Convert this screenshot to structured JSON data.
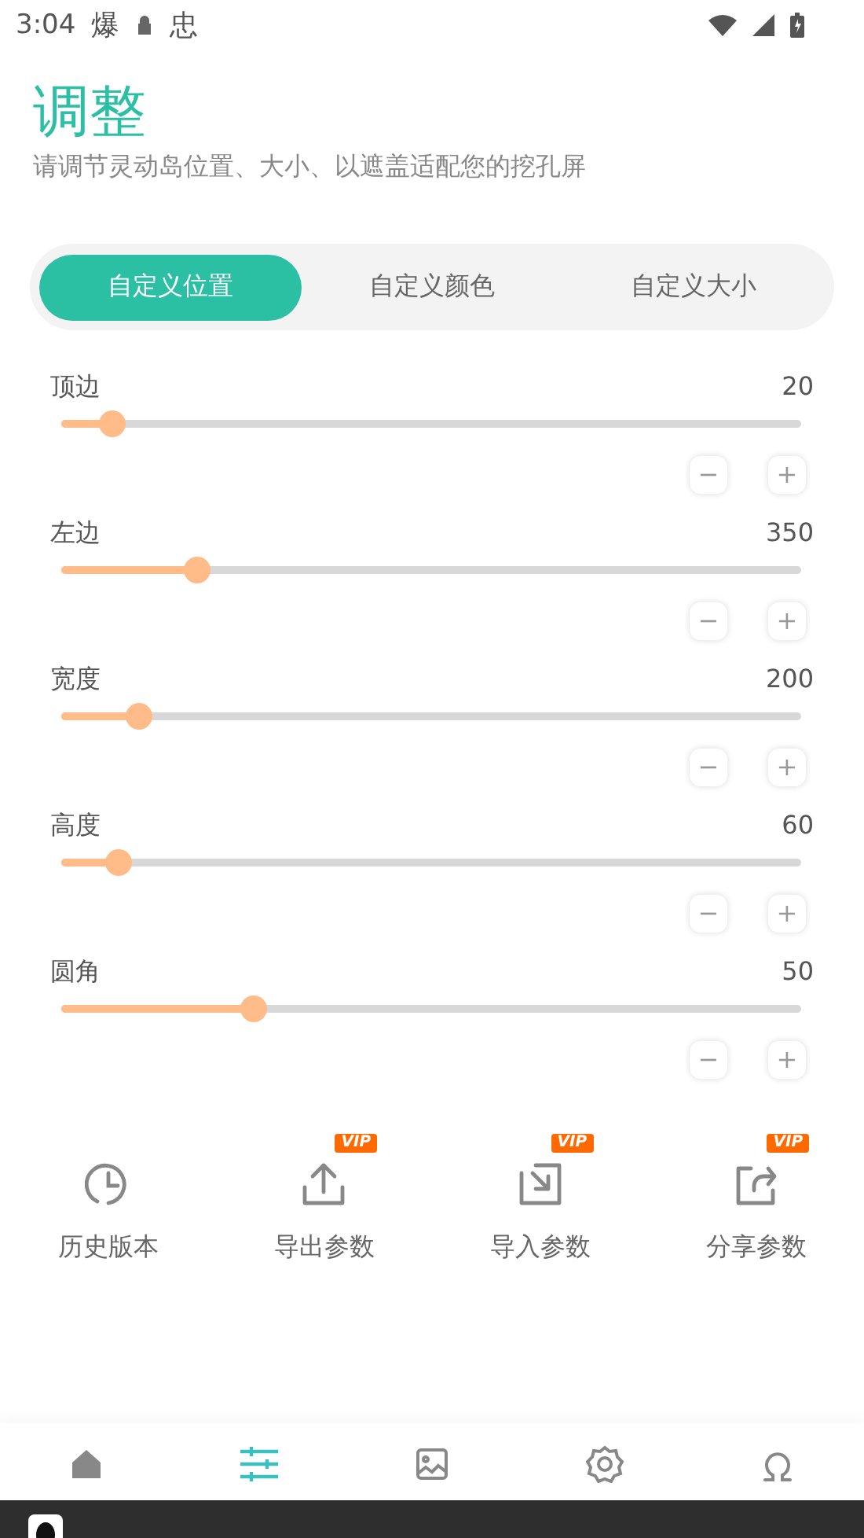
{
  "status_bar": {
    "time": "3:04",
    "notice_glyphs": [
      "爆",
      "忠"
    ]
  },
  "header": {
    "title": "调整",
    "subtitle": "请调节灵动岛位置、大小、以遮盖适配您的挖孔屏"
  },
  "tabs": [
    {
      "label": "自定义位置",
      "selected": true
    },
    {
      "label": "自定义颜色",
      "selected": false
    },
    {
      "label": "自定义大小",
      "selected": false
    }
  ],
  "sliders": [
    {
      "label": "顶边",
      "value": "20",
      "level": 0.066,
      "minus": "−",
      "plus": "+"
    },
    {
      "label": "左边",
      "value": "350",
      "level": 0.176,
      "minus": "−",
      "plus": "+"
    },
    {
      "label": "宽度",
      "value": "200",
      "level": 0.1,
      "minus": "−",
      "plus": "+"
    },
    {
      "label": "高度",
      "value": "60",
      "level": 0.074,
      "minus": "−",
      "plus": "+"
    },
    {
      "label": "圆角",
      "value": "50",
      "level": 0.25,
      "minus": "−",
      "plus": "+"
    }
  ],
  "actions": [
    {
      "kind": "history",
      "label": "历史版本"
    },
    {
      "kind": "export",
      "label": "导出参数",
      "badge": "VIP"
    },
    {
      "kind": "import",
      "label": "导入参数",
      "badge": "VIP"
    },
    {
      "kind": "share",
      "label": "分享参数",
      "badge": "VIP"
    }
  ],
  "bottom_nav": [
    {
      "kind": "home",
      "selected": false
    },
    {
      "kind": "adjust",
      "selected": true
    },
    {
      "kind": "wallpaper",
      "selected": false
    },
    {
      "kind": "settings",
      "selected": false
    },
    {
      "kind": "profile",
      "selected": false
    }
  ]
}
